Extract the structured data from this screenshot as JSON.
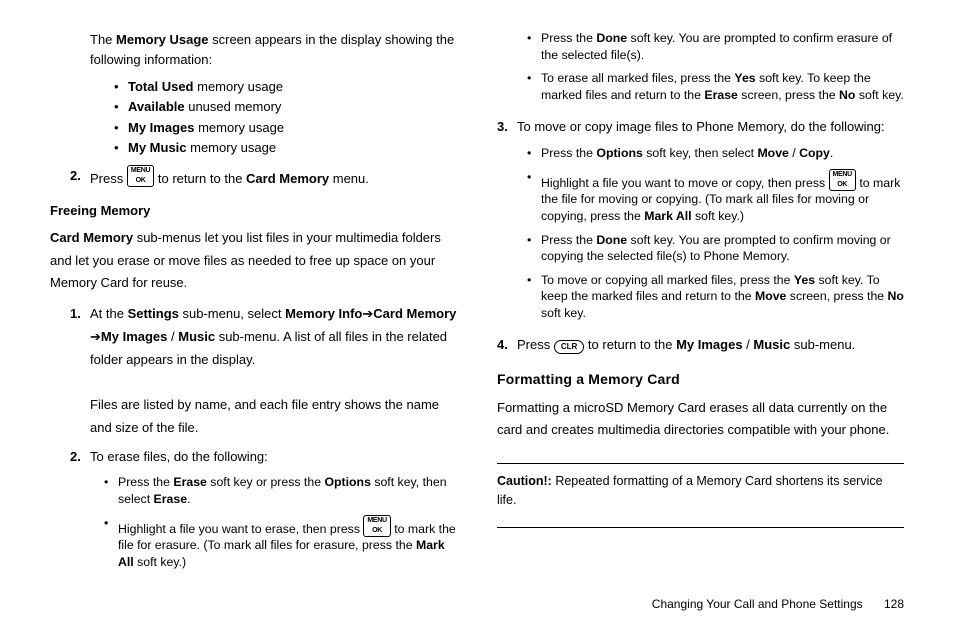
{
  "col1": {
    "p1a": "The ",
    "p1b": "Memory Usage",
    "p1c": " screen appears in the display showing the following information:",
    "ul1": {
      "li1a": "Total Used",
      "li1b": " memory usage",
      "li2a": "Available",
      "li2b": " unused memory",
      "li3a": "My Images",
      "li3b": " memory usage",
      "li4a": "My Music",
      "li4b": " memory usage"
    },
    "step2": {
      "num": "2.",
      "a": "Press ",
      "key": "MENU\nOK",
      "b": " to return to the ",
      "c": "Card Memory",
      "d": " menu."
    },
    "h4": "Freeing Memory",
    "p2": {
      "a": "Card Memory",
      "b": " sub-menus let you list files in your multimedia folders and let you erase or move files as needed to free up space on your Memory Card for reuse."
    },
    "s1": {
      "num": "1.",
      "a": "At the ",
      "b": "Settings",
      "c": " sub-menu, select ",
      "d": "Memory Info",
      "arr1": " ➔ ",
      "e": "Card Memory",
      "arr2": " ➔ ",
      "f": "My Images",
      "g": " / ",
      "h": "Music",
      "i": " sub-menu. A list of all files in the related folder appears in the display.",
      "p2": "Files are listed by name, and each file entry shows the name and size of the file."
    },
    "s2": {
      "num": "2.",
      "a": "To erase files, do the following:"
    },
    "ul2": {
      "li1": {
        "a": "Press the ",
        "b": "Erase",
        "c": " soft key or press the ",
        "d": "Options",
        "e": " soft key, then select ",
        "f": "Erase",
        "g": "."
      },
      "li2": {
        "a": "Highlight a file you want to erase, then press ",
        "key": "MENU\nOK",
        "b": " to mark the file for erasure. (To mark all files for erasure, press the ",
        "c": "Mark All",
        "d": " soft key.)"
      }
    }
  },
  "col2": {
    "ul1": {
      "li1": {
        "a": "Press the ",
        "b": "Done",
        "c": " soft key. You are prompted to confirm erasure of the selected file(s)."
      },
      "li2": {
        "a": "To erase all marked files, press the ",
        "b": "Yes",
        "c": " soft key. To keep the marked files and return to the ",
        "d": "Erase",
        "e": " screen, press the ",
        "f": "No",
        "g": " soft key."
      }
    },
    "s3": {
      "num": "3.",
      "a": "To move or copy image files to Phone Memory, do the following:"
    },
    "ul2": {
      "li1": {
        "a": "Press the ",
        "b": "Options",
        "c": " soft key, then select ",
        "d": "Move",
        "e": " / ",
        "f": "Copy",
        "g": "."
      },
      "li2": {
        "a": "Highlight a file you want to move or copy, then press ",
        "key": "MENU\nOK",
        "b": " to mark the file for moving or copying. (To mark all files for moving or copying, press the ",
        "c": "Mark All",
        "d": " soft key.)"
      },
      "li3": {
        "a": "Press the ",
        "b": "Done",
        "c": " soft key. You are prompted to confirm moving or copying the selected file(s) to Phone Memory."
      },
      "li4": {
        "a": "To move or copying all marked files, press the ",
        "b": "Yes",
        "c": " soft key. To keep the marked files and return to the ",
        "d": "Move",
        "e": " screen, press the ",
        "f": "No",
        "g": " soft key."
      }
    },
    "s4": {
      "num": "4.",
      "a": "Press ",
      "key": "CLR",
      "b": " to return to the ",
      "c": "My Images",
      "d": " / ",
      "e": "Music",
      "f": " sub-menu."
    },
    "h3": "Formatting a Memory Card",
    "p1": "Formatting a microSD Memory Card erases all data currently on the card and creates multimedia directories compatible with your phone.",
    "caution": {
      "a": "Caution!:",
      "b": " Repeated formatting of a Memory Card shortens its service life."
    }
  },
  "footer": {
    "section": "Changing Your Call and Phone Settings",
    "page": "128"
  }
}
